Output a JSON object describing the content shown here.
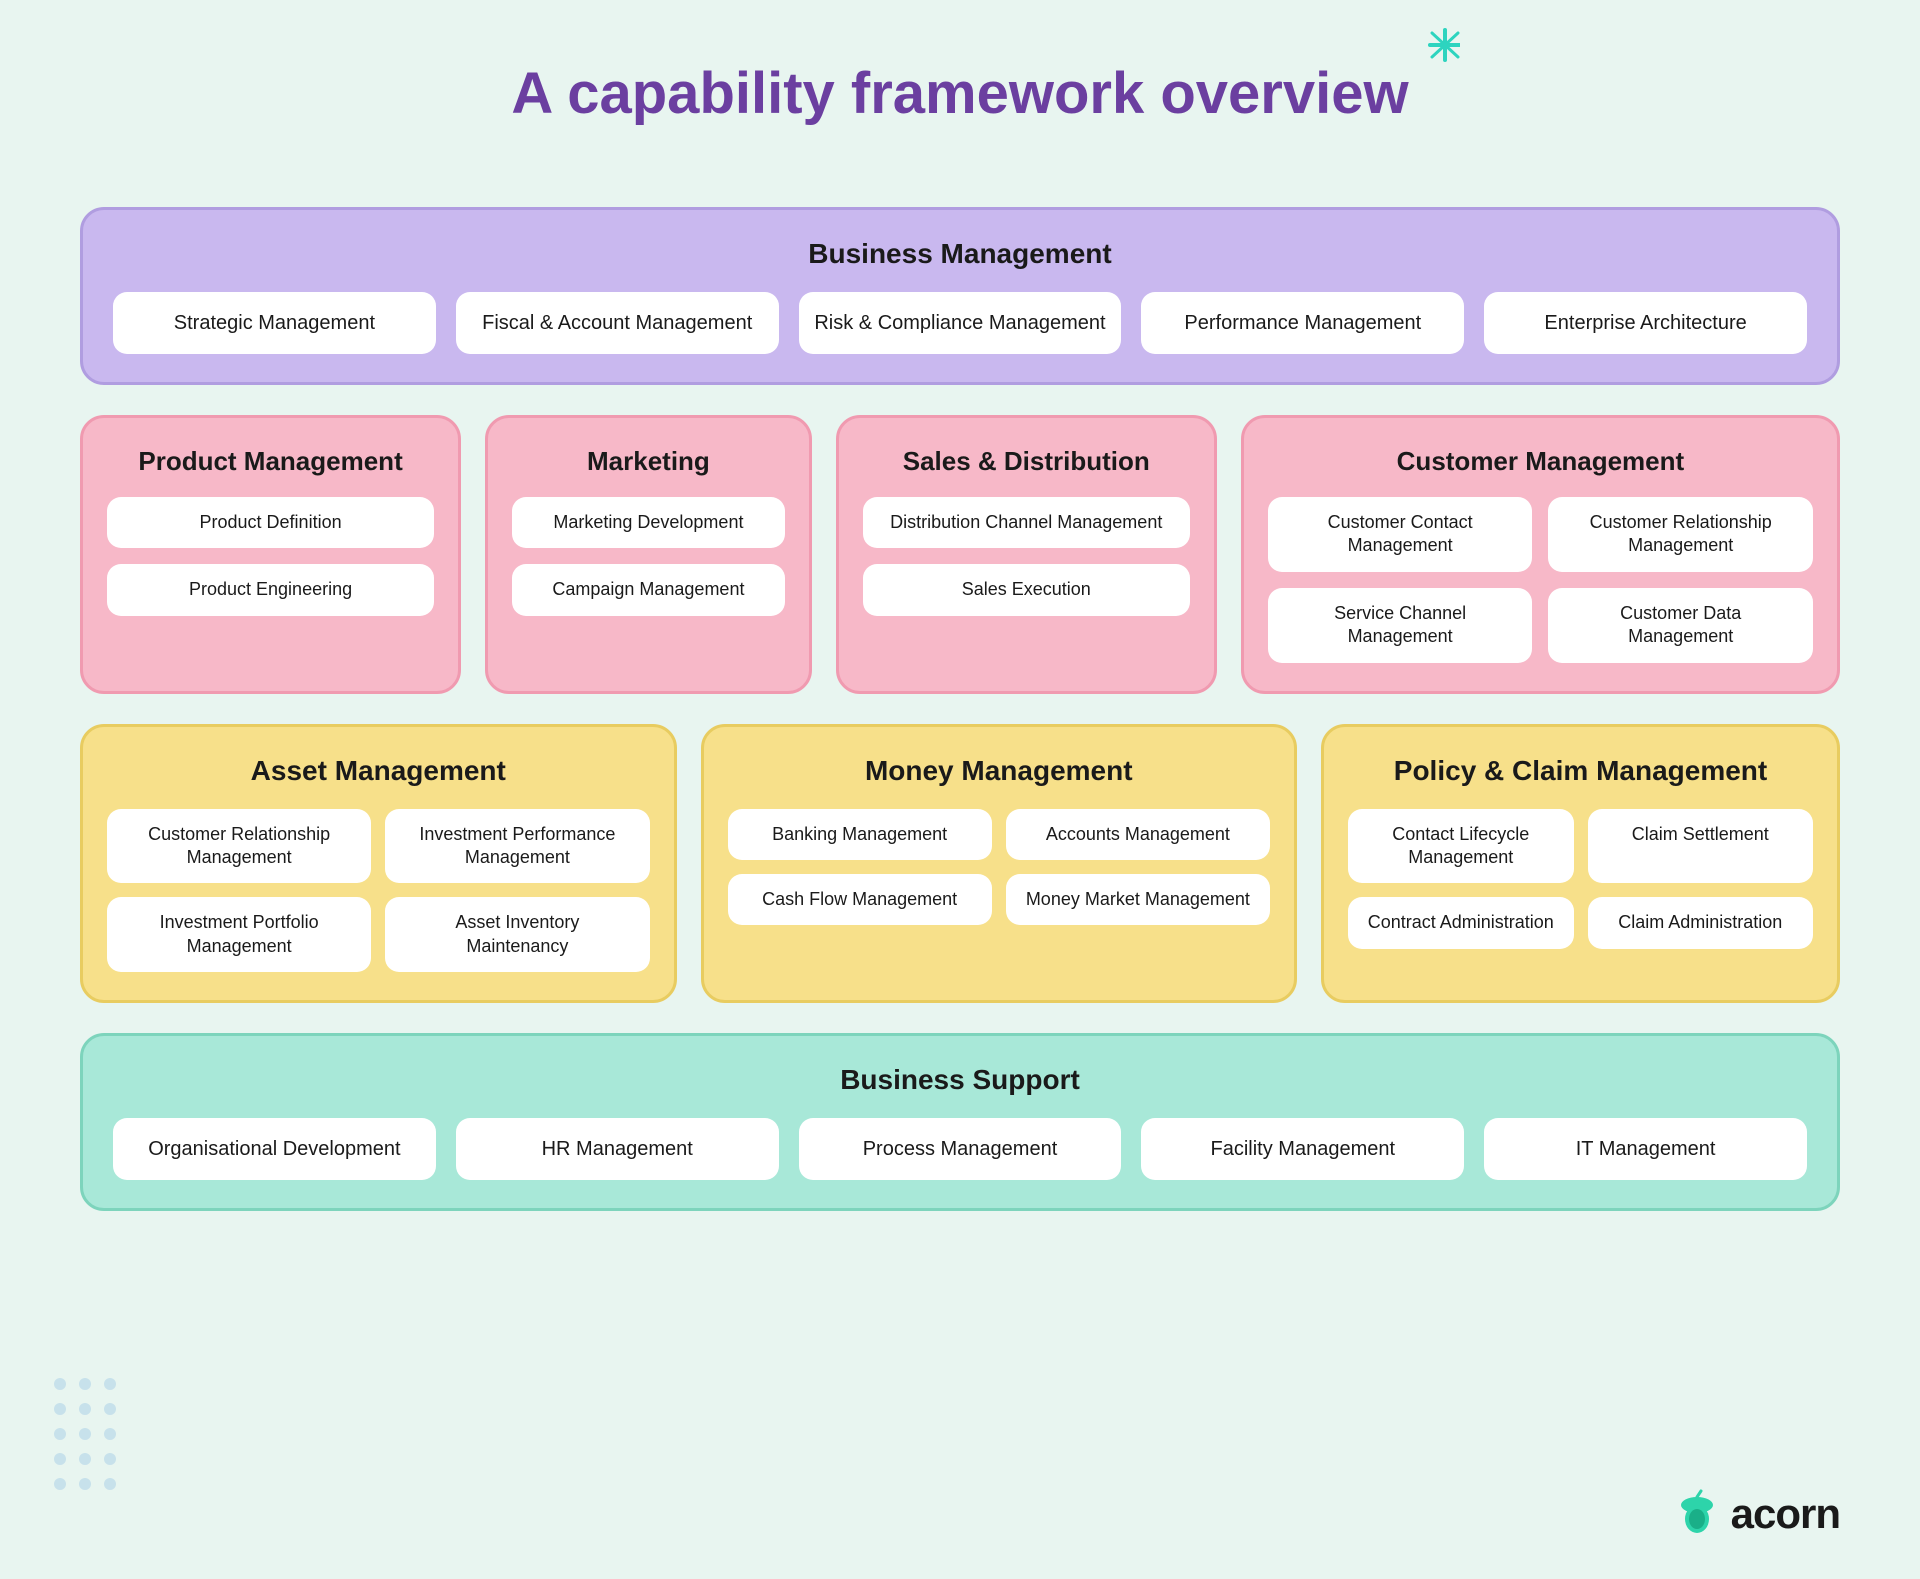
{
  "page": {
    "title": "A capability framework overview",
    "background_color": "#e8f5f0"
  },
  "sections": {
    "business_management": {
      "title": "Business Management",
      "cards": [
        "Strategic Management",
        "Fiscal & Account Management",
        "Risk & Compliance Management",
        "Performance Management",
        "Enterprise Architecture"
      ]
    },
    "product_management": {
      "title": "Product Management",
      "cards": [
        "Product Definition",
        "Product Engineering"
      ]
    },
    "marketing": {
      "title": "Marketing",
      "cards": [
        "Marketing Development",
        "Campaign Management"
      ]
    },
    "sales_distribution": {
      "title": "Sales & Distribution",
      "cards": [
        "Distribution Channel Management",
        "Sales Execution"
      ]
    },
    "customer_management": {
      "title": "Customer Management",
      "cards": [
        "Customer Contact Management",
        "Customer Relationship Management",
        "Service Channel Management",
        "Customer Data Management"
      ]
    },
    "asset_management": {
      "title": "Asset Management",
      "cards": [
        "Customer Relationship Management",
        "Investment Performance Management",
        "Investment Portfolio Management",
        "Asset Inventory Maintenancy"
      ]
    },
    "money_management": {
      "title": "Money Management",
      "cards": [
        "Banking Management",
        "Accounts Management",
        "Cash Flow Management",
        "Money Market Management"
      ]
    },
    "policy_claim": {
      "title": "Policy & Claim Management",
      "cards": [
        "Contact Lifecycle Management",
        "Claim Settlement",
        "Contract Administration",
        "Claim Administration"
      ]
    },
    "business_support": {
      "title": "Business Support",
      "cards": [
        "Organisational Development",
        "HR Management",
        "Process Management",
        "Facility Management",
        "IT Management"
      ]
    }
  },
  "logo": {
    "text": "acorn"
  }
}
